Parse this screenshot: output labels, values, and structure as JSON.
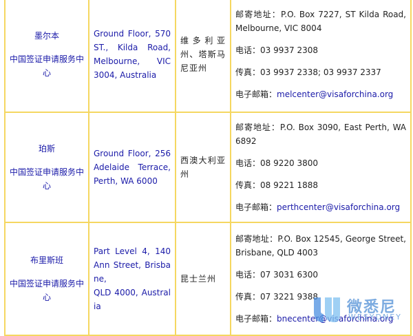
{
  "rows": [
    {
      "city": "墨尔本",
      "center": "中国签证申请服务中心",
      "address": [
        "Ground Floor, 570",
        "ST., Kilda Road,",
        "Melbourne, VIC",
        "3004, Australia"
      ],
      "area": "维多利亚州、塔斯马尼亚州",
      "post": "邮寄地址：P.O. Box 7227, ST Kilda Road, Melbourne, VIC 8004",
      "phone": "电话：03 9937 2308",
      "fax": "传真：03 9937 2338; 03 9937 2337",
      "email_label": "电子邮箱：",
      "email": "melcenter@visaforchina.org"
    },
    {
      "city": "珀斯",
      "center": "中国签证申请服务中心",
      "address": [
        "Ground Floor, 256",
        "Adelaide Terrace,",
        "Perth, WA 6000"
      ],
      "area": "西澳大利亚州",
      "post": "邮寄地址：P.O. Box 3090, East Perth, WA 6892",
      "phone": "电话：08 9220 3800",
      "fax": "传真：08 9221 1888",
      "email_label": "电子邮箱：",
      "email": "perthcenter@visaforchina.org"
    },
    {
      "city": "布里斯班",
      "center": "中国签证申请服务中心",
      "address": [
        "Part Level 4, 140",
        "Ann Street, Brisbane,",
        "QLD 4000, Australia"
      ],
      "area": "昆士兰州",
      "post": "邮寄地址：P.O. Box 12545, George Street, Brisbane, QLD 4003",
      "phone": "电话：07 3031 6300",
      "fax": "传真：07 3221 9388",
      "email_label": "电子邮箱：",
      "email": "bnecenter@visaforchina.org"
    }
  ],
  "watermark": {
    "title": "微悉尼",
    "subtitle": "WESYDNEY",
    "color": "#6aa0dc"
  }
}
